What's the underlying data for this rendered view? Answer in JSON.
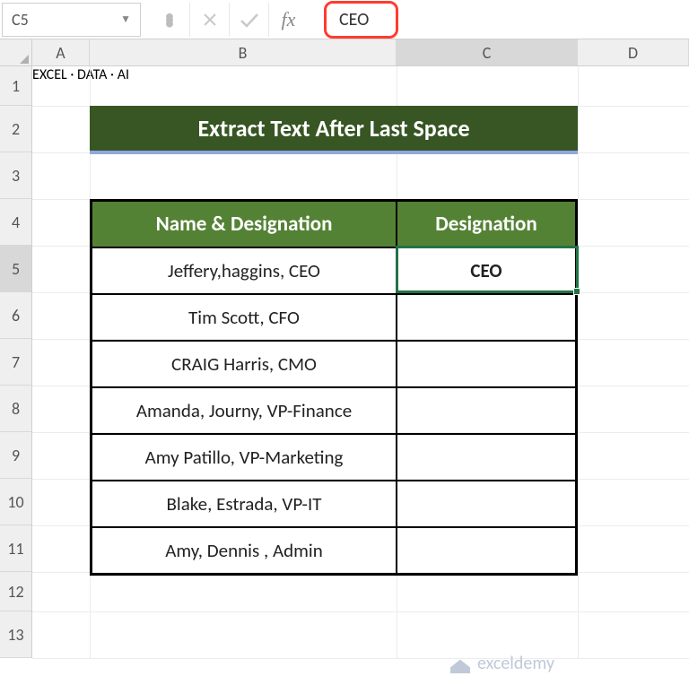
{
  "formula_bar": {
    "name_box": "C5",
    "formula_value": "CEO"
  },
  "columns": [
    "A",
    "B",
    "C",
    "D"
  ],
  "rows": [
    "1",
    "2",
    "3",
    "4",
    "5",
    "6",
    "7",
    "8",
    "9",
    "10",
    "11",
    "12",
    "13"
  ],
  "title": "Extract Text After Last Space",
  "table": {
    "headers": {
      "name": "Name & Designation",
      "designation": "Designation"
    },
    "rows": [
      {
        "name": "Jeffery,haggins, CEO",
        "designation": "CEO"
      },
      {
        "name": "Tim Scott, CFO",
        "designation": ""
      },
      {
        "name": "CRAIG Harris, CMO",
        "designation": ""
      },
      {
        "name": "Amanda, Journy, VP-Finance",
        "designation": ""
      },
      {
        "name": "Amy Patillo, VP-Marketing",
        "designation": ""
      },
      {
        "name": "Blake, Estrada, VP-IT",
        "designation": ""
      },
      {
        "name": "Amy, Dennis , Admin",
        "designation": ""
      }
    ]
  },
  "selected_cell": "C5",
  "watermark": {
    "brand": "exceldemy",
    "tagline": "EXCEL · DATA · AI"
  },
  "colors": {
    "header_green": "#548235",
    "title_green": "#375623",
    "accent_blue": "#8ea9db",
    "selection": "#217346",
    "callout": "#ff3b30"
  }
}
